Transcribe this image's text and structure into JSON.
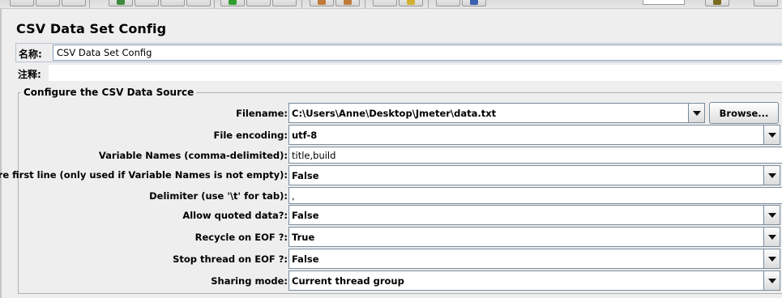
{
  "panel": {
    "title": "CSV Data Set Config"
  },
  "name_field": {
    "label": "名称:",
    "value": "CSV Data Set Config"
  },
  "comments_field": {
    "label": "注释:",
    "value": ""
  },
  "csv_source": {
    "group_title": "Configure the CSV Data Source",
    "browse_label": "Browse...",
    "fields": {
      "filename": {
        "label": "Filename:",
        "value": "C:\\Users\\Anne\\Desktop\\Jmeter\\data.txt"
      },
      "encoding": {
        "label": "File encoding:",
        "value": "utf-8"
      },
      "variable_names": {
        "label": "Variable Names (comma-delimited):",
        "value": "title,build"
      },
      "ignore_first_line": {
        "label": "Ignore first line (only used if Variable Names is not empty):",
        "value": "False"
      },
      "delimiter": {
        "label": "Delimiter (use '\\t' for tab):",
        "value": ","
      },
      "allow_quoted": {
        "label": "Allow quoted data?:",
        "value": "False"
      },
      "recycle_eof": {
        "label": "Recycle on EOF ?:",
        "value": "True"
      },
      "stop_thread_eof": {
        "label": "Stop thread on EOF ?:",
        "value": "False"
      },
      "sharing_mode": {
        "label": "Sharing mode:",
        "value": "Current thread group"
      }
    }
  },
  "toolbar": {
    "icons": [
      "open-icon",
      "save-icon",
      "cut-icon",
      "copy-icon",
      "paste-icon",
      "expand-icon",
      "collapse-icon",
      "toggle-icon",
      "start-icon",
      "start-no-pause-icon",
      "stop-icon",
      "shutdown-icon",
      "remote-start-icon",
      "remote-stop-icon",
      "clear-icon",
      "clear-all-icon",
      "search-icon",
      "reset-search-icon",
      "function-helper-icon",
      "help-icon"
    ]
  }
}
